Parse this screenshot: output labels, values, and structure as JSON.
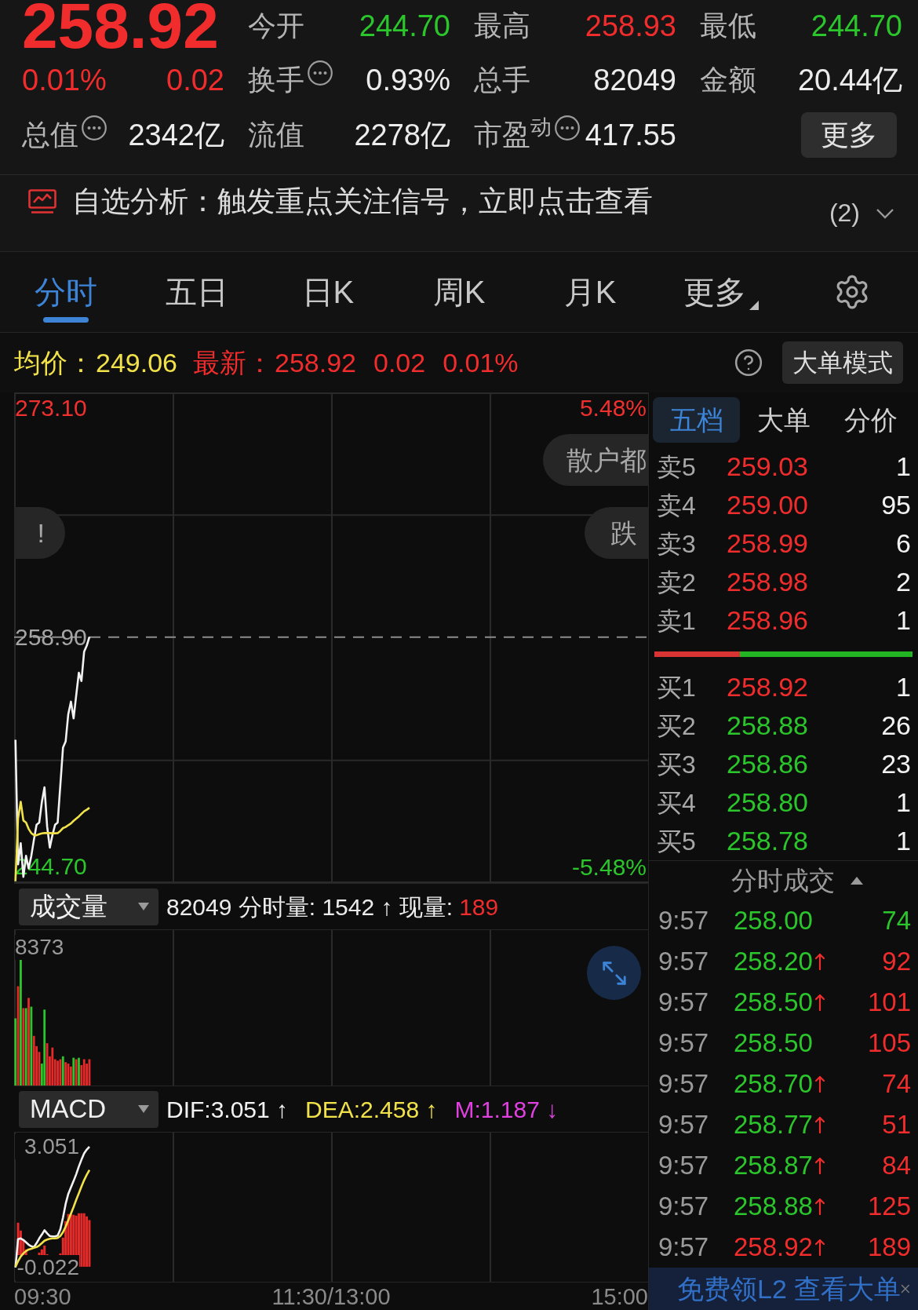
{
  "quote": {
    "price": "258.92",
    "change_pct": "0.01%",
    "change": "0.02",
    "color": "#f02c2c"
  },
  "stats": [
    {
      "label": "今开",
      "value": "244.70",
      "color": "#2bc62b",
      "info": false
    },
    {
      "label": "最高",
      "value": "258.93",
      "color": "#f02c2c",
      "info": false
    },
    {
      "label": "最低",
      "value": "244.70",
      "color": "#2bc62b",
      "info": false
    },
    {
      "label": "换手",
      "value": "0.93%",
      "color": "#ececec",
      "info": true
    },
    {
      "label": "总手",
      "value": "82049",
      "color": "#ececec",
      "info": false
    },
    {
      "label": "金额",
      "value": "20.44亿",
      "color": "#ececec",
      "info": false
    },
    {
      "label": "总值",
      "value": "2342亿",
      "color": "#ececec",
      "info": true
    },
    {
      "label": "流值",
      "value": "2278亿",
      "color": "#ececec",
      "info": false
    },
    {
      "label": "市盈$^{动}$",
      "value": "417.55",
      "color": "#ececec",
      "info": true
    }
  ],
  "more_button": "更多",
  "alert": {
    "text": "自选分析：触发重点关注信号，立即点击查看",
    "count": "(2)",
    "expanded": false
  },
  "tabs": [
    {
      "label": "分时",
      "selected": true,
      "kind": "tab"
    },
    {
      "label": "五日",
      "selected": false,
      "kind": "tab"
    },
    {
      "label": "日K",
      "selected": false,
      "kind": "tab"
    },
    {
      "label": "周K",
      "selected": false,
      "kind": "tab"
    },
    {
      "label": "月K",
      "selected": false,
      "kind": "tab"
    },
    {
      "label": "更多",
      "selected": false,
      "kind": "menu"
    }
  ],
  "summary": [
    {
      "label": "均价：",
      "values": [
        "249.06"
      ],
      "color": "#f2e24a"
    },
    {
      "label": "最新：",
      "values": [
        "258.92",
        "0.02",
        "0.01%"
      ],
      "color": "#f02c2c"
    }
  ],
  "big_order_button": "大单模式",
  "price_chart": {
    "chart_data": {
      "type": "line",
      "categories": [
        null,
        null,
        null,
        null,
        null,
        null,
        null,
        null,
        null,
        null,
        null,
        null,
        null,
        null,
        null,
        null,
        null,
        null,
        null,
        null,
        null,
        null,
        null,
        null,
        null,
        null,
        null,
        null,
        null,
        null,
        null,
        null,
        null,
        null,
        null,
        null,
        null,
        null,
        null,
        null,
        null,
        null,
        null,
        null,
        null,
        null,
        null,
        null,
        null,
        null,
        null,
        null,
        null,
        null,
        null,
        null,
        null,
        null,
        null,
        null,
        null,
        null,
        null,
        null,
        null,
        null,
        null,
        null,
        null,
        null,
        null,
        null,
        null,
        null,
        null,
        null,
        null,
        null,
        null,
        null,
        null,
        null,
        null,
        null,
        null,
        null,
        null,
        null,
        null,
        null,
        null,
        null,
        null,
        null,
        null,
        null,
        null,
        null,
        null,
        null,
        null,
        null,
        null,
        null,
        null,
        null,
        null,
        null,
        null,
        null,
        null,
        null,
        null,
        null,
        null,
        null,
        null,
        null,
        null,
        null,
        null,
        null,
        null,
        null,
        null,
        null,
        null,
        null,
        null,
        null,
        null,
        null,
        null,
        null,
        null,
        null,
        null,
        null,
        null,
        null,
        null,
        null,
        null,
        null,
        null,
        null,
        null,
        null,
        null,
        null,
        null,
        null,
        null,
        null,
        null,
        null,
        null,
        null,
        null,
        null,
        null,
        null,
        null,
        null,
        null,
        null,
        null,
        null,
        null,
        null,
        null,
        null,
        null,
        null,
        null,
        null,
        null,
        null,
        null,
        null,
        null,
        null,
        null,
        null,
        null,
        null,
        null,
        null,
        null,
        null,
        null,
        null,
        null,
        null,
        null,
        null,
        null,
        null,
        null,
        null,
        null,
        null,
        null,
        null,
        null,
        null,
        null,
        null,
        null,
        null,
        null,
        null,
        null,
        null,
        null,
        null,
        null,
        null,
        null,
        null,
        null,
        null,
        null,
        null,
        null,
        null,
        null,
        null,
        null,
        null,
        null,
        null,
        null,
        null,
        null,
        null,
        null,
        null,
        null,
        null
      ],
      "ylim": [
        243.68,
        274.05
      ],
      "yticks": [
        {
          "value": 273.1,
          "label": "273.10"
        },
        {
          "value": 258.9,
          "label": "258.90"
        },
        {
          "value": 244.7,
          "label": "244.70"
        }
      ],
      "ref_lines": [
        {
          "axis": "y",
          "value": 258.9
        }
      ],
      "series": [
        {
          "color": "#f2f2f2",
          "values": [
            252.55,
            244.83,
            246.14,
            244.06,
            245.36,
            244.58,
            245.36,
            246.38,
            247.29,
            247.42,
            248.71,
            249.61,
            247.17,
            245.87,
            246.64,
            247.29,
            247.42,
            249.74,
            252.06,
            252.45,
            254.13,
            254.91,
            253.87,
            255.29,
            256.7,
            256.19,
            258.0,
            258.38,
            258.92,
            null,
            null,
            null,
            null,
            null,
            null,
            null,
            null,
            null,
            null,
            null,
            null,
            null,
            null,
            null,
            null,
            null,
            null,
            null,
            null,
            null,
            null,
            null,
            null,
            null,
            null,
            null,
            null,
            null,
            null,
            null,
            null,
            null,
            null,
            null,
            null,
            null,
            null,
            null,
            null,
            null,
            null,
            null,
            null,
            null,
            null,
            null,
            null,
            null,
            null,
            null,
            null,
            null,
            null,
            null,
            null,
            null,
            null,
            null,
            null,
            null,
            null,
            null,
            null,
            null,
            null,
            null,
            null,
            null,
            null,
            null,
            null,
            null,
            null,
            null,
            null,
            null,
            null,
            null,
            null,
            null,
            null,
            null,
            null,
            null,
            null,
            null,
            null,
            null,
            null,
            null,
            null,
            null,
            null,
            null,
            null,
            null,
            null,
            null,
            null,
            null,
            null,
            null,
            null,
            null,
            null,
            null,
            null,
            null,
            null,
            null,
            null,
            null,
            null,
            null,
            null,
            null,
            null,
            null,
            null,
            null,
            null,
            null,
            null,
            null,
            null,
            null,
            null,
            null,
            null,
            null,
            null,
            null,
            null,
            null,
            null,
            null,
            null,
            null,
            null,
            null,
            null,
            null,
            null,
            null,
            null,
            null,
            null,
            null,
            null,
            null,
            null,
            null,
            null,
            null,
            null,
            null,
            null,
            null,
            null,
            null,
            null,
            null,
            null,
            null,
            null,
            null,
            null,
            null,
            null,
            null,
            null,
            null,
            null,
            null,
            null,
            null,
            null,
            null,
            null,
            null,
            null,
            null,
            null,
            null,
            null,
            null,
            null,
            null,
            null,
            null,
            null,
            null,
            null,
            null,
            null,
            null,
            null,
            null,
            null,
            null,
            null,
            null,
            null,
            null,
            null,
            null,
            null,
            null,
            null,
            null
          ]
        },
        {
          "color": "#f2e24a",
          "values": [
            243.79,
            247.68,
            248.71,
            247.55,
            247.42,
            247.03,
            246.77,
            246.64,
            246.64,
            246.7,
            246.75,
            246.77,
            246.77,
            246.77,
            246.76,
            246.76,
            246.77,
            246.9,
            247.08,
            247.15,
            247.26,
            247.37,
            247.53,
            247.66,
            247.8,
            247.96,
            248.12,
            248.22,
            248.34,
            null,
            null,
            null,
            null,
            null,
            null,
            null,
            null,
            null,
            null,
            null,
            null,
            null,
            null,
            null,
            null,
            null,
            null,
            null,
            null,
            null,
            null,
            null,
            null,
            null,
            null,
            null,
            null,
            null,
            null,
            null,
            null,
            null,
            null,
            null,
            null,
            null,
            null,
            null,
            null,
            null,
            null,
            null,
            null,
            null,
            null,
            null,
            null,
            null,
            null,
            null,
            null,
            null,
            null,
            null,
            null,
            null,
            null,
            null,
            null,
            null,
            null,
            null,
            null,
            null,
            null,
            null,
            null,
            null,
            null,
            null,
            null,
            null,
            null,
            null,
            null,
            null,
            null,
            null,
            null,
            null,
            null,
            null,
            null,
            null,
            null,
            null,
            null,
            null,
            null,
            null,
            null,
            null,
            null,
            null,
            null,
            null,
            null,
            null,
            null,
            null,
            null,
            null,
            null,
            null,
            null,
            null,
            null,
            null,
            null,
            null,
            null,
            null,
            null,
            null,
            null,
            null,
            null,
            null,
            null,
            null,
            null,
            null,
            null,
            null,
            null,
            null,
            null,
            null,
            null,
            null,
            null,
            null,
            null,
            null,
            null,
            null,
            null,
            null,
            null,
            null,
            null,
            null,
            null,
            null,
            null,
            null,
            null,
            null,
            null,
            null,
            null,
            null,
            null,
            null,
            null,
            null,
            null,
            null,
            null,
            null,
            null,
            null,
            null,
            null,
            null,
            null,
            null,
            null,
            null,
            null,
            null,
            null,
            null,
            null,
            null,
            null,
            null,
            null,
            null,
            null,
            null,
            null,
            null,
            null,
            null,
            null,
            null,
            null,
            null,
            null,
            null,
            null,
            null,
            null,
            null,
            null,
            null,
            null,
            null,
            null,
            null,
            null,
            null,
            null,
            null,
            null,
            null,
            null,
            null,
            null
          ]
        }
      ]
    },
    "pct_ticks": [
      "5.48%",
      "-5.48%"
    ],
    "bubbles": [
      "散户都",
      "!",
      "跌"
    ]
  },
  "volume_panel": {
    "indicator": "成交量",
    "readout": [
      {
        "text": "82049 分时量: 1542 ↑ 现量:",
        "color": "#ececec"
      },
      {
        "text": "189",
        "color": "#f02c2c"
      }
    ],
    "max_label": "8373"
  },
  "macd_panel": {
    "indicator": "MACD",
    "legend": [
      {
        "text": "DIF:3.051 ↑",
        "color": "#f2f2f2"
      },
      {
        "text": "DEA:2.458 ↑",
        "color": "#f2e24a"
      },
      {
        "text": "M:1.187 ↓",
        "color": "#e040e0"
      }
    ],
    "chart_data": {
      "type": "line",
      "categories": [
        null,
        null,
        null,
        null,
        null,
        null,
        null,
        null,
        null,
        null,
        null,
        null,
        null,
        null,
        null,
        null,
        null,
        null,
        null,
        null,
        null,
        null,
        null,
        null,
        null,
        null,
        null,
        null,
        null,
        null,
        null,
        null,
        null,
        null,
        null,
        null,
        null,
        null,
        null,
        null,
        null,
        null,
        null,
        null,
        null,
        null,
        null,
        null,
        null,
        null,
        null,
        null,
        null,
        null,
        null,
        null,
        null,
        null,
        null,
        null,
        null,
        null,
        null,
        null,
        null,
        null,
        null,
        null,
        null,
        null,
        null,
        null,
        null,
        null,
        null,
        null,
        null,
        null,
        null,
        null,
        null,
        null,
        null,
        null,
        null,
        null,
        null,
        null,
        null,
        null,
        null,
        null,
        null,
        null,
        null,
        null,
        null,
        null,
        null,
        null,
        null,
        null,
        null,
        null,
        null,
        null,
        null,
        null,
        null,
        null,
        null,
        null,
        null,
        null,
        null,
        null,
        null,
        null,
        null,
        null,
        null,
        null,
        null,
        null,
        null,
        null,
        null,
        null,
        null,
        null,
        null,
        null,
        null,
        null,
        null,
        null,
        null,
        null,
        null,
        null,
        null,
        null,
        null,
        null,
        null,
        null,
        null,
        null,
        null,
        null,
        null,
        null,
        null,
        null,
        null,
        null,
        null,
        null,
        null,
        null,
        null,
        null,
        null,
        null,
        null,
        null,
        null,
        null,
        null,
        null,
        null,
        null,
        null,
        null,
        null,
        null,
        null,
        null,
        null,
        null,
        null,
        null,
        null,
        null,
        null,
        null,
        null,
        null,
        null,
        null,
        null,
        null,
        null,
        null,
        null,
        null,
        null,
        null,
        null,
        null,
        null,
        null,
        null,
        null,
        null,
        null,
        null,
        null,
        null,
        null,
        null,
        null,
        null,
        null,
        null,
        null,
        null,
        null,
        null,
        null,
        null,
        null,
        null,
        null,
        null,
        null,
        null,
        null,
        null,
        null,
        null,
        null,
        null,
        null,
        null,
        null,
        null,
        null,
        null,
        null
      ],
      "ylim": [
        -0.381,
        3.41
      ],
      "yticks": [
        {
          "value": 3.051,
          "label": "3.051"
        },
        {
          "value": -0.022,
          "label": "-0.022"
        }
      ],
      "series": [
        {
          "color": "#f2f2f2",
          "values": [
            -0.02,
            0.7,
            0.72,
            0.68,
            0.62,
            0.56,
            0.52,
            0.5,
            0.6,
            0.72,
            0.82,
            0.93,
            0.85,
            0.78,
            0.77,
            0.77,
            0.79,
            0.95,
            1.25,
            1.6,
            1.85,
            2.02,
            2.18,
            2.35,
            2.55,
            2.72,
            2.88,
            2.98,
            3.05,
            null,
            null,
            null,
            null,
            null,
            null,
            null,
            null,
            null,
            null,
            null,
            null,
            null,
            null,
            null,
            null,
            null,
            null,
            null,
            null,
            null,
            null,
            null,
            null,
            null,
            null,
            null,
            null,
            null,
            null,
            null,
            null,
            null,
            null,
            null,
            null,
            null,
            null,
            null,
            null,
            null,
            null,
            null,
            null,
            null,
            null,
            null,
            null,
            null,
            null,
            null,
            null,
            null,
            null,
            null,
            null,
            null,
            null,
            null,
            null,
            null,
            null,
            null,
            null,
            null,
            null,
            null,
            null,
            null,
            null,
            null,
            null,
            null,
            null,
            null,
            null,
            null,
            null,
            null,
            null,
            null,
            null,
            null,
            null,
            null,
            null,
            null,
            null,
            null,
            null,
            null,
            null,
            null,
            null,
            null,
            null,
            null,
            null,
            null,
            null,
            null,
            null,
            null,
            null,
            null,
            null,
            null,
            null,
            null,
            null,
            null,
            null,
            null,
            null,
            null,
            null,
            null,
            null,
            null,
            null,
            null,
            null,
            null,
            null,
            null,
            null,
            null,
            null,
            null,
            null,
            null,
            null,
            null,
            null,
            null,
            null,
            null,
            null,
            null,
            null,
            null,
            null,
            null,
            null,
            null,
            null,
            null,
            null,
            null,
            null,
            null,
            null,
            null,
            null,
            null,
            null,
            null,
            null,
            null,
            null,
            null,
            null,
            null,
            null,
            null,
            null,
            null,
            null,
            null,
            null,
            null,
            null,
            null,
            null,
            null,
            null,
            null,
            null,
            null,
            null,
            null,
            null,
            null,
            null,
            null,
            null,
            null,
            null,
            null,
            null,
            null,
            null,
            null,
            null,
            null,
            null,
            null,
            null,
            null,
            null,
            null,
            null,
            null,
            null,
            null,
            null,
            null,
            null,
            null,
            null,
            null
          ]
        },
        {
          "color": "#f2e24a",
          "values": [
            0,
            0.14,
            0.26,
            0.34,
            0.4,
            0.44,
            0.46,
            0.48,
            0.5,
            0.54,
            0.6,
            0.66,
            0.69,
            0.71,
            0.72,
            0.72,
            0.73,
            0.78,
            0.88,
            1.02,
            1.18,
            1.35,
            1.52,
            1.7,
            1.87,
            2.04,
            2.2,
            2.34,
            2.46,
            null,
            null,
            null,
            null,
            null,
            null,
            null,
            null,
            null,
            null,
            null,
            null,
            null,
            null,
            null,
            null,
            null,
            null,
            null,
            null,
            null,
            null,
            null,
            null,
            null,
            null,
            null,
            null,
            null,
            null,
            null,
            null,
            null,
            null,
            null,
            null,
            null,
            null,
            null,
            null,
            null,
            null,
            null,
            null,
            null,
            null,
            null,
            null,
            null,
            null,
            null,
            null,
            null,
            null,
            null,
            null,
            null,
            null,
            null,
            null,
            null,
            null,
            null,
            null,
            null,
            null,
            null,
            null,
            null,
            null,
            null,
            null,
            null,
            null,
            null,
            null,
            null,
            null,
            null,
            null,
            null,
            null,
            null,
            null,
            null,
            null,
            null,
            null,
            null,
            null,
            null,
            null,
            null,
            null,
            null,
            null,
            null,
            null,
            null,
            null,
            null,
            null,
            null,
            null,
            null,
            null,
            null,
            null,
            null,
            null,
            null,
            null,
            null,
            null,
            null,
            null,
            null,
            null,
            null,
            null,
            null,
            null,
            null,
            null,
            null,
            null,
            null,
            null,
            null,
            null,
            null,
            null,
            null,
            null,
            null,
            null,
            null,
            null,
            null,
            null,
            null,
            null,
            null,
            null,
            null,
            null,
            null,
            null,
            null,
            null,
            null,
            null,
            null,
            null,
            null,
            null,
            null,
            null,
            null,
            null,
            null,
            null,
            null,
            null,
            null,
            null,
            null,
            null,
            null,
            null,
            null,
            null,
            null,
            null,
            null,
            null,
            null,
            null,
            null,
            null,
            null,
            null,
            null,
            null,
            null,
            null,
            null,
            null,
            null,
            null,
            null,
            null,
            null,
            null,
            null,
            null,
            null,
            null,
            null,
            null,
            null,
            null,
            null,
            null,
            null,
            null,
            null,
            null,
            null,
            null,
            null
          ]
        }
      ]
    }
  },
  "time_axis": [
    "09:30",
    "11:30/13:00",
    "15:00"
  ],
  "order_book": {
    "tabs": [
      {
        "label": "五档",
        "selected": true
      },
      {
        "label": "大单",
        "selected": false
      },
      {
        "label": "分价",
        "selected": false
      }
    ],
    "asks": [
      {
        "label": "卖5",
        "price": "259.03",
        "color": "#f02c2c",
        "volume": "1"
      },
      {
        "label": "卖4",
        "price": "259.00",
        "color": "#f02c2c",
        "volume": "95"
      },
      {
        "label": "卖3",
        "price": "258.99",
        "color": "#f02c2c",
        "volume": "6"
      },
      {
        "label": "卖2",
        "price": "258.98",
        "color": "#f02c2c",
        "volume": "2"
      },
      {
        "label": "卖1",
        "price": "258.96",
        "color": "#f02c2c",
        "volume": "1"
      }
    ],
    "ratio": {
      "level": 0.33
    },
    "bids": [
      {
        "label": "买1",
        "price": "258.92",
        "color": "#f02c2c",
        "volume": "1"
      },
      {
        "label": "买2",
        "price": "258.88",
        "color": "#2bc62b",
        "volume": "26"
      },
      {
        "label": "买3",
        "price": "258.86",
        "color": "#2bc62b",
        "volume": "23"
      },
      {
        "label": "买4",
        "price": "258.80",
        "color": "#2bc62b",
        "volume": "1"
      },
      {
        "label": "买5",
        "price": "258.78",
        "color": "#2bc62b",
        "volume": "1"
      }
    ]
  },
  "trades": {
    "title": "分时成交",
    "expanded": true,
    "rows": [
      {
        "time": "9:57",
        "price": {
          "text": "258.00",
          "color": "#2bc62b"
        },
        "uptick": false,
        "volume": {
          "text": "74",
          "color": "#2bc62b"
        }
      },
      {
        "time": "9:57",
        "price": {
          "text": "258.20",
          "color": "#2bc62b"
        },
        "uptick": true,
        "volume": {
          "text": "92",
          "color": "#f02c2c"
        }
      },
      {
        "time": "9:57",
        "price": {
          "text": "258.50",
          "color": "#2bc62b"
        },
        "uptick": true,
        "volume": {
          "text": "101",
          "color": "#f02c2c"
        }
      },
      {
        "time": "9:57",
        "price": {
          "text": "258.50",
          "color": "#2bc62b"
        },
        "uptick": false,
        "volume": {
          "text": "105",
          "color": "#f02c2c"
        }
      },
      {
        "time": "9:57",
        "price": {
          "text": "258.70",
          "color": "#2bc62b"
        },
        "uptick": true,
        "volume": {
          "text": "74",
          "color": "#f02c2c"
        }
      },
      {
        "time": "9:57",
        "price": {
          "text": "258.77",
          "color": "#2bc62b"
        },
        "uptick": true,
        "volume": {
          "text": "51",
          "color": "#f02c2c"
        }
      },
      {
        "time": "9:57",
        "price": {
          "text": "258.87",
          "color": "#2bc62b"
        },
        "uptick": true,
        "volume": {
          "text": "84",
          "color": "#f02c2c"
        }
      },
      {
        "time": "9:57",
        "price": {
          "text": "258.88",
          "color": "#2bc62b"
        },
        "uptick": true,
        "volume": {
          "text": "125",
          "color": "#f02c2c"
        }
      },
      {
        "time": "9:57",
        "price": {
          "text": "258.92",
          "color": "#f02c2c"
        },
        "uptick": true,
        "volume": {
          "text": "189",
          "color": "#f02c2c"
        }
      }
    ]
  },
  "banner": {
    "text": "免费领L2 查看大单"
  }
}
